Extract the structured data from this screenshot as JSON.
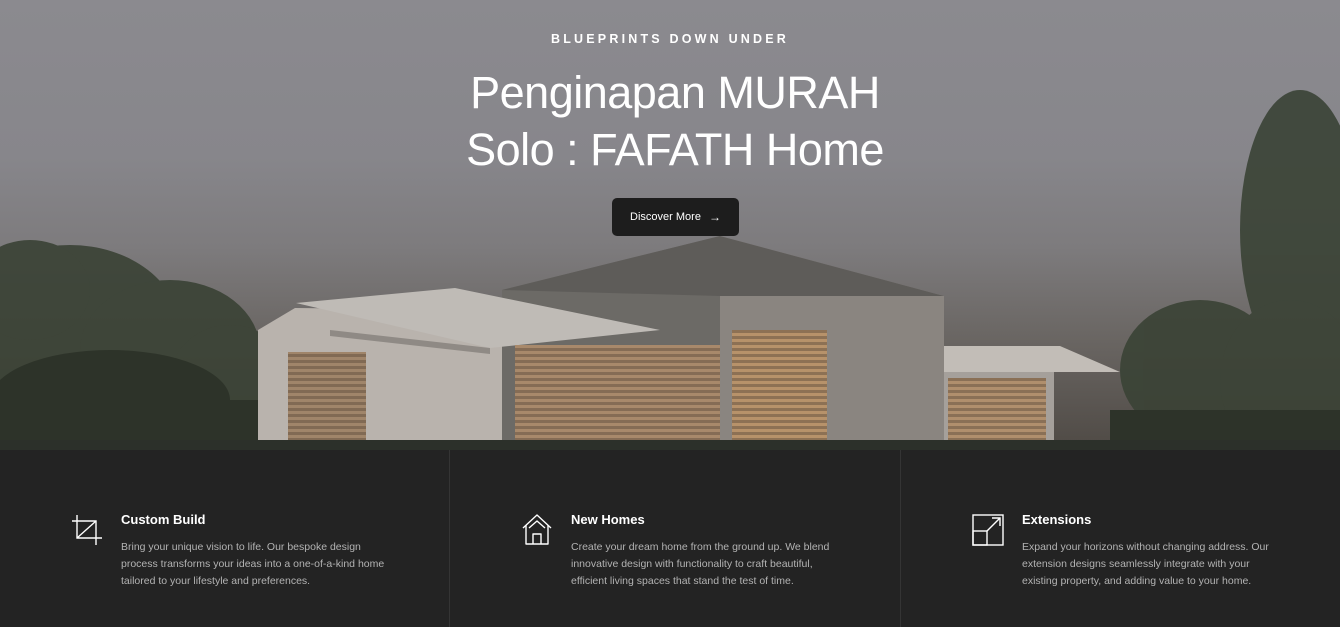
{
  "hero": {
    "eyebrow": "BLUEPRINTS DOWN UNDER",
    "title_line1": "Penginapan MURAH",
    "title_line2": "Solo : FAFATH Home",
    "cta_label": "Discover More",
    "cta_icon": "arrow-right-icon"
  },
  "features": [
    {
      "icon": "crop-icon",
      "title": "Custom Build",
      "description": "Bring your unique vision to life. Our bespoke design process transforms your ideas into a one-of-a-kind home tailored to your lifestyle and preferences."
    },
    {
      "icon": "house-icon",
      "title": "New Homes",
      "description": "Create your dream home from the ground up. We blend innovative design with functionality to craft beautiful, efficient living spaces that stand the test of time."
    },
    {
      "icon": "expand-icon",
      "title": "Extensions",
      "description": "Expand your horizons without changing address. Our extension designs seamlessly integrate with your existing property, and adding value to your home."
    }
  ],
  "colors": {
    "button_bg": "#1d1d1d",
    "features_bg": "#232323",
    "feature_text": "#b3b3b3"
  }
}
